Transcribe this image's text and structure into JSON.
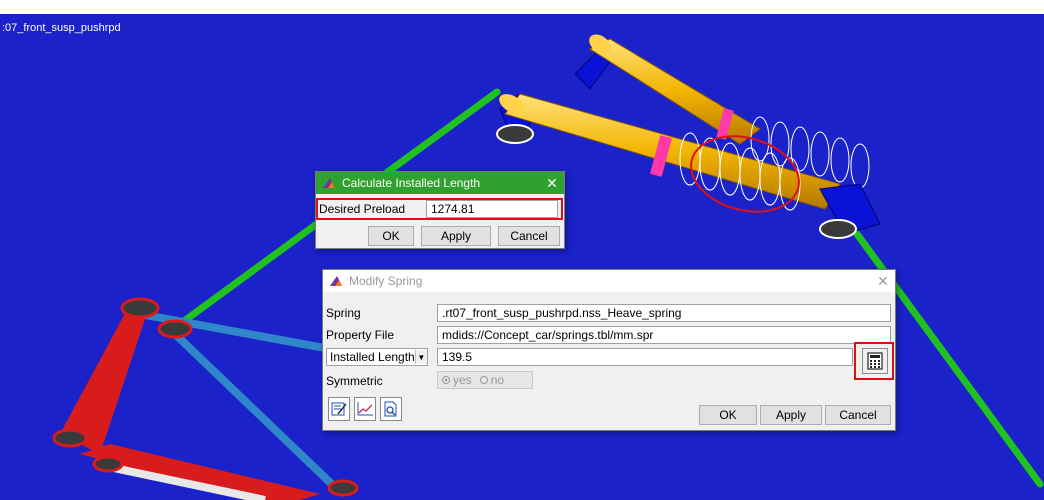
{
  "model": {
    "name": ":07_front_susp_pushrpd"
  },
  "colors": {
    "viewport": "#1b22c9",
    "calc_title_bar": "#2fa12e",
    "highlight": "#e01010"
  },
  "calc_dialog": {
    "title": "Calculate Installed Length",
    "close": "✕",
    "preload_label": "Desired Preload",
    "preload_value": "1274.81",
    "ok": "OK",
    "apply": "Apply",
    "cancel": "Cancel"
  },
  "spring_dialog": {
    "title": "Modify Spring",
    "close": "✕",
    "spring_label": "Spring",
    "spring_value": ".rt07_front_susp_pushrpd.nss_Heave_spring",
    "property_label": "Property File",
    "property_value": "mdids://Concept_car/springs.tbl/mm.spr",
    "length_mode": "Installed Length",
    "length_value": "139.5",
    "symmetric_label": "Symmetric",
    "symmetric_yes": "yes",
    "symmetric_no": "no",
    "symmetric_selected": "yes",
    "ok": "OK",
    "apply": "Apply",
    "cancel": "Cancel",
    "tool_icons": [
      "edit-property-icon",
      "plot-curve-icon",
      "view-file-icon"
    ]
  }
}
